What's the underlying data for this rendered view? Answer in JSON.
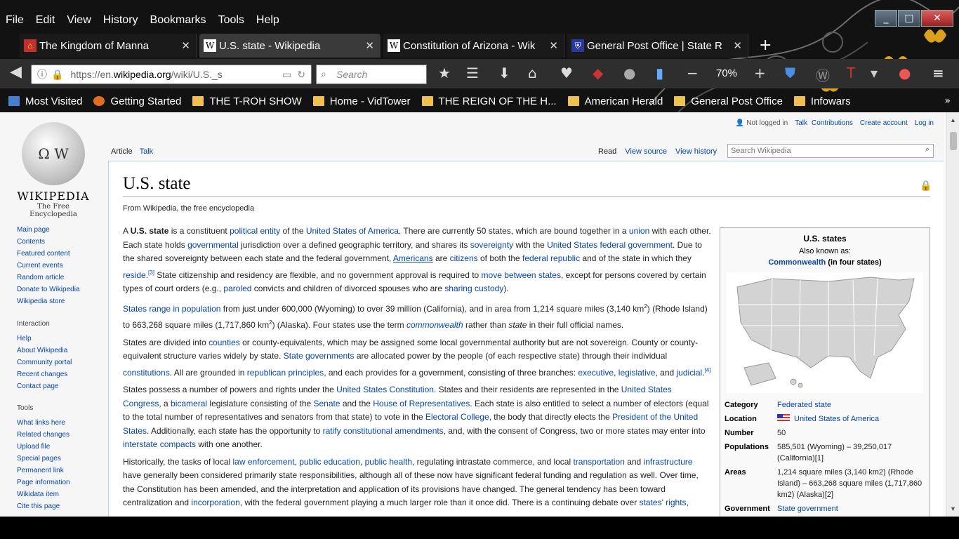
{
  "menu": [
    "File",
    "Edit",
    "View",
    "History",
    "Bookmarks",
    "Tools",
    "Help"
  ],
  "tabs": [
    {
      "title": "The Kingdom of Manna",
      "icon": "kingdom-icon",
      "active": false
    },
    {
      "title": "U.S. state - Wikipedia",
      "icon": "wikipedia-icon",
      "active": true
    },
    {
      "title": "Constitution of Arizona - Wik",
      "icon": "wikipedia-icon",
      "active": false
    },
    {
      "title": "General Post Office | State R",
      "icon": "shield-icon",
      "active": false
    }
  ],
  "url": {
    "prefix": "https://en.",
    "domain": "wikipedia.org",
    "path": "/wiki/U.S._s"
  },
  "search_placeholder": "Search",
  "zoom": "70%",
  "bookmarks": [
    "Most Visited",
    "Getting Started",
    "THE T-ROH SHOW",
    "Home - VidTower",
    "THE REIGN OF THE H...",
    "American Herald",
    "General Post Office",
    "Infowars"
  ],
  "wiki": {
    "wordmark": "WIKIPEDIA",
    "tagline": "The Free Encyclopedia",
    "nav": [
      "Main page",
      "Contents",
      "Featured content",
      "Current events",
      "Random article",
      "Donate to Wikipedia",
      "Wikipedia store"
    ],
    "interaction_head": "Interaction",
    "interaction": [
      "Help",
      "About Wikipedia",
      "Community portal",
      "Recent changes",
      "Contact page"
    ],
    "tools_head": "Tools",
    "tools": [
      "What links here",
      "Related changes",
      "Upload file",
      "Special pages",
      "Permanent link",
      "Page information",
      "Wikidata item",
      "Cite this page"
    ],
    "personal": {
      "notlogged": "Not logged in",
      "talk": "Talk",
      "contrib": "Contributions",
      "create": "Create account",
      "login": "Log in"
    },
    "tab_article": "Article",
    "tab_talk": "Talk",
    "tab_read": "Read",
    "tab_source": "View source",
    "tab_history": "View history",
    "search_placeholder": "Search Wikipedia",
    "title": "U.S. state",
    "from": "From Wikipedia, the free encyclopedia"
  },
  "infobox": {
    "title": "U.S. states",
    "aka": "Also known as:",
    "aka_link": "Commonwealth",
    "aka_rest": " (in four states)",
    "rows": [
      {
        "k": "Category",
        "v": "Federated state"
      },
      {
        "k": "Location",
        "v": "United States of America"
      },
      {
        "k": "Number",
        "v": "50"
      },
      {
        "k": "Populations",
        "v": "585,501 (Wyoming) – 39,250,017 (California)[1]"
      },
      {
        "k": "Areas",
        "v": "1,214 square miles (3,140 km2) (Rhode Island) – 663,268 square miles (1,717,860 km2) (Alaska)[2]"
      },
      {
        "k": "Government",
        "v": "State government"
      }
    ]
  }
}
